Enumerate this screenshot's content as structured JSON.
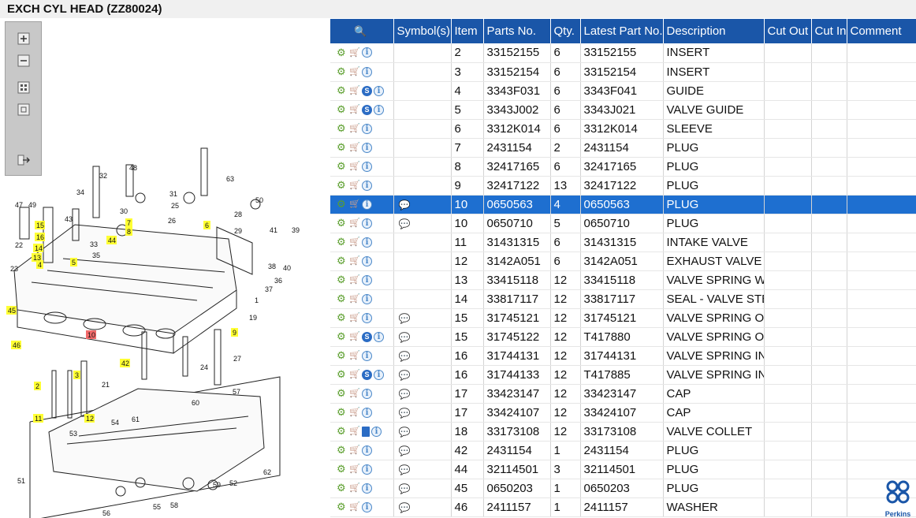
{
  "title": "EXCH CYL HEAD (ZZ80024)",
  "zoom_tools": [
    "zoom-in",
    "zoom-out",
    "fit-all",
    "fit-page",
    "export"
  ],
  "diagram": {
    "numbers": [
      "48",
      "32",
      "31",
      "63",
      "34",
      "30",
      "25",
      "28",
      "50",
      "49",
      "47",
      "43",
      "26",
      "6",
      "29",
      "41",
      "39",
      "15",
      "7",
      "44",
      "8",
      "16",
      "33",
      "14",
      "35",
      "13",
      "22",
      "4",
      "5",
      "38",
      "40",
      "23",
      "36",
      "37",
      "1",
      "45",
      "19",
      "10",
      "9",
      "46",
      "42",
      "27",
      "24",
      "3",
      "21",
      "2",
      "11",
      "12",
      "60",
      "57",
      "61",
      "54",
      "53",
      "62",
      "51",
      "52",
      "59",
      "55",
      "58",
      "56"
    ],
    "highlighted": [
      "15",
      "16",
      "14",
      "13",
      "4",
      "5",
      "7",
      "8",
      "44",
      "6",
      "45",
      "46",
      "9",
      "42",
      "2",
      "3",
      "11",
      "12"
    ],
    "selected": "10"
  },
  "grid": {
    "headers": [
      "",
      "Symbol(s)",
      "Item",
      "Parts No.",
      "Qty.",
      "Latest Part No.",
      "Description",
      "Cut Out",
      "Cut In",
      "Comment"
    ],
    "rows": [
      {
        "icons": [
          "gear",
          "cart",
          "info"
        ],
        "sym": "",
        "item": "2",
        "part": "33152155",
        "qty": "6",
        "latest": "33152155",
        "desc": "INSERT"
      },
      {
        "icons": [
          "gear",
          "cart",
          "info"
        ],
        "sym": "",
        "item": "3",
        "part": "33152154",
        "qty": "6",
        "latest": "33152154",
        "desc": "INSERT"
      },
      {
        "icons": [
          "gear",
          "cart",
          "s",
          "info"
        ],
        "sym": "",
        "item": "4",
        "part": "3343F031",
        "qty": "6",
        "latest": "3343F041",
        "desc": "GUIDE"
      },
      {
        "icons": [
          "gear",
          "cart",
          "s",
          "info"
        ],
        "sym": "",
        "item": "5",
        "part": "3343J002",
        "qty": "6",
        "latest": "3343J021",
        "desc": "VALVE GUIDE"
      },
      {
        "icons": [
          "gear",
          "cart",
          "info"
        ],
        "sym": "",
        "item": "6",
        "part": "3312K014",
        "qty": "6",
        "latest": "3312K014",
        "desc": "SLEEVE"
      },
      {
        "icons": [
          "gear",
          "cart",
          "info"
        ],
        "sym": "",
        "item": "7",
        "part": "2431154",
        "qty": "2",
        "latest": "2431154",
        "desc": "PLUG"
      },
      {
        "icons": [
          "gear",
          "cart",
          "info"
        ],
        "sym": "",
        "item": "8",
        "part": "32417165",
        "qty": "6",
        "latest": "32417165",
        "desc": "PLUG"
      },
      {
        "icons": [
          "gear",
          "cart",
          "info"
        ],
        "sym": "",
        "item": "9",
        "part": "32417122",
        "qty": "13",
        "latest": "32417122",
        "desc": "PLUG"
      },
      {
        "icons": [
          "gear",
          "cart",
          "info"
        ],
        "sym": "note",
        "item": "10",
        "part": "0650563",
        "qty": "4",
        "latest": "0650563",
        "desc": "PLUG",
        "selected": true
      },
      {
        "icons": [
          "gear",
          "cart",
          "info"
        ],
        "sym": "note",
        "item": "10",
        "part": "0650710",
        "qty": "5",
        "latest": "0650710",
        "desc": "PLUG"
      },
      {
        "icons": [
          "gear",
          "cart",
          "info"
        ],
        "sym": "",
        "item": "11",
        "part": "31431315",
        "qty": "6",
        "latest": "31431315",
        "desc": "INTAKE VALVE"
      },
      {
        "icons": [
          "gear",
          "cart",
          "info"
        ],
        "sym": "",
        "item": "12",
        "part": "3142A051",
        "qty": "6",
        "latest": "3142A051",
        "desc": "EXHAUST VALVE"
      },
      {
        "icons": [
          "gear",
          "cart",
          "info"
        ],
        "sym": "",
        "item": "13",
        "part": "33415118",
        "qty": "12",
        "latest": "33415118",
        "desc": "VALVE SPRING WA"
      },
      {
        "icons": [
          "gear",
          "cart",
          "info"
        ],
        "sym": "",
        "item": "14",
        "part": "33817117",
        "qty": "12",
        "latest": "33817117",
        "desc": "SEAL - VALVE STEI"
      },
      {
        "icons": [
          "gear",
          "cart",
          "info"
        ],
        "sym": "note",
        "item": "15",
        "part": "31745121",
        "qty": "12",
        "latest": "31745121",
        "desc": "VALVE SPRING OU"
      },
      {
        "icons": [
          "gear",
          "cart",
          "s",
          "info"
        ],
        "sym": "note",
        "item": "15",
        "part": "31745122",
        "qty": "12",
        "latest": "T417880",
        "desc": "VALVE SPRING OU"
      },
      {
        "icons": [
          "gear",
          "cart",
          "info"
        ],
        "sym": "note",
        "item": "16",
        "part": "31744131",
        "qty": "12",
        "latest": "31744131",
        "desc": "VALVE SPRING INN"
      },
      {
        "icons": [
          "gear",
          "cart",
          "s",
          "info"
        ],
        "sym": "note",
        "item": "16",
        "part": "31744133",
        "qty": "12",
        "latest": "T417885",
        "desc": "VALVE SPRING INN"
      },
      {
        "icons": [
          "gear",
          "cart",
          "info"
        ],
        "sym": "note",
        "item": "17",
        "part": "33423147",
        "qty": "12",
        "latest": "33423147",
        "desc": "CAP"
      },
      {
        "icons": [
          "gear",
          "cart",
          "info"
        ],
        "sym": "note",
        "item": "17",
        "part": "33424107",
        "qty": "12",
        "latest": "33424107",
        "desc": "CAP"
      },
      {
        "icons": [
          "gear",
          "cart",
          "book",
          "info"
        ],
        "sym": "note",
        "item": "18",
        "part": "33173108",
        "qty": "12",
        "latest": "33173108",
        "desc": "VALVE COLLET"
      },
      {
        "icons": [
          "gear",
          "cart",
          "info"
        ],
        "sym": "note",
        "item": "42",
        "part": "2431154",
        "qty": "1",
        "latest": "2431154",
        "desc": "PLUG"
      },
      {
        "icons": [
          "gear",
          "cart",
          "info"
        ],
        "sym": "note",
        "item": "44",
        "part": "32114501",
        "qty": "3",
        "latest": "32114501",
        "desc": "PLUG"
      },
      {
        "icons": [
          "gear",
          "cart",
          "info"
        ],
        "sym": "note",
        "item": "45",
        "part": "0650203",
        "qty": "1",
        "latest": "0650203",
        "desc": "PLUG"
      },
      {
        "icons": [
          "gear",
          "cart",
          "info"
        ],
        "sym": "note",
        "item": "46",
        "part": "2411157",
        "qty": "1",
        "latest": "2411157",
        "desc": "WASHER"
      }
    ]
  },
  "logo": {
    "text": "Perkins",
    "color": "#1a56a8"
  },
  "colors": {
    "header": "#1a56a8",
    "selected": "#1e6fd0",
    "callout": "#ffff33",
    "callout_selected": "#f26b6b"
  }
}
